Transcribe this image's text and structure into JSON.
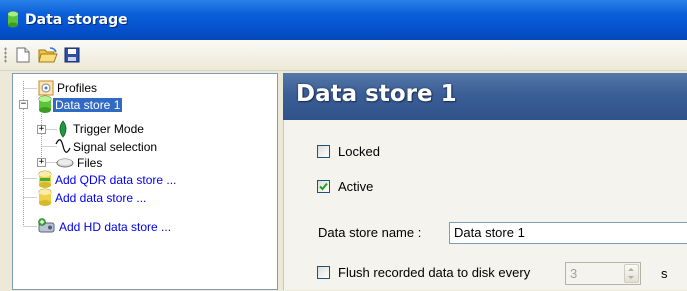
{
  "window": {
    "title": "Data storage"
  },
  "toolbar": {
    "buttons": [
      {
        "name": "new",
        "icon": "new-document-icon"
      },
      {
        "name": "open",
        "icon": "open-folder-icon"
      },
      {
        "name": "save",
        "icon": "save-disk-icon"
      }
    ]
  },
  "tree": {
    "items": [
      {
        "label": "Profiles",
        "icon": "profiles-icon"
      },
      {
        "label": "Data store 1",
        "icon": "data-store-icon",
        "selected": true,
        "expanded": true
      },
      {
        "label": "Trigger Mode",
        "icon": "trigger-icon",
        "expandable": true
      },
      {
        "label": "Signal selection",
        "icon": "signal-wave-icon"
      },
      {
        "label": "Files",
        "icon": "files-icon",
        "expandable": true
      },
      {
        "label": "Add QDR data store ...",
        "icon": "add-qdr-store-icon",
        "link": true
      },
      {
        "label": "Add data store ...",
        "icon": "add-store-icon",
        "link": true
      },
      {
        "label": "Add HD data store ...",
        "icon": "add-hd-store-icon",
        "link": true
      }
    ]
  },
  "details": {
    "header_title": "Data store 1",
    "locked": {
      "label": "Locked",
      "checked": false
    },
    "active": {
      "label": "Active",
      "checked": true
    },
    "name_label": "Data store name :",
    "name_value": "Data store 1",
    "flush": {
      "label": "Flush recorded data to disk every",
      "checked": false,
      "value": "3",
      "unit": "s"
    }
  },
  "colors": {
    "titlebar": "#0a5fd8",
    "selection": "#316ac5",
    "header": "#3a5e96",
    "link": "#0000ee"
  }
}
